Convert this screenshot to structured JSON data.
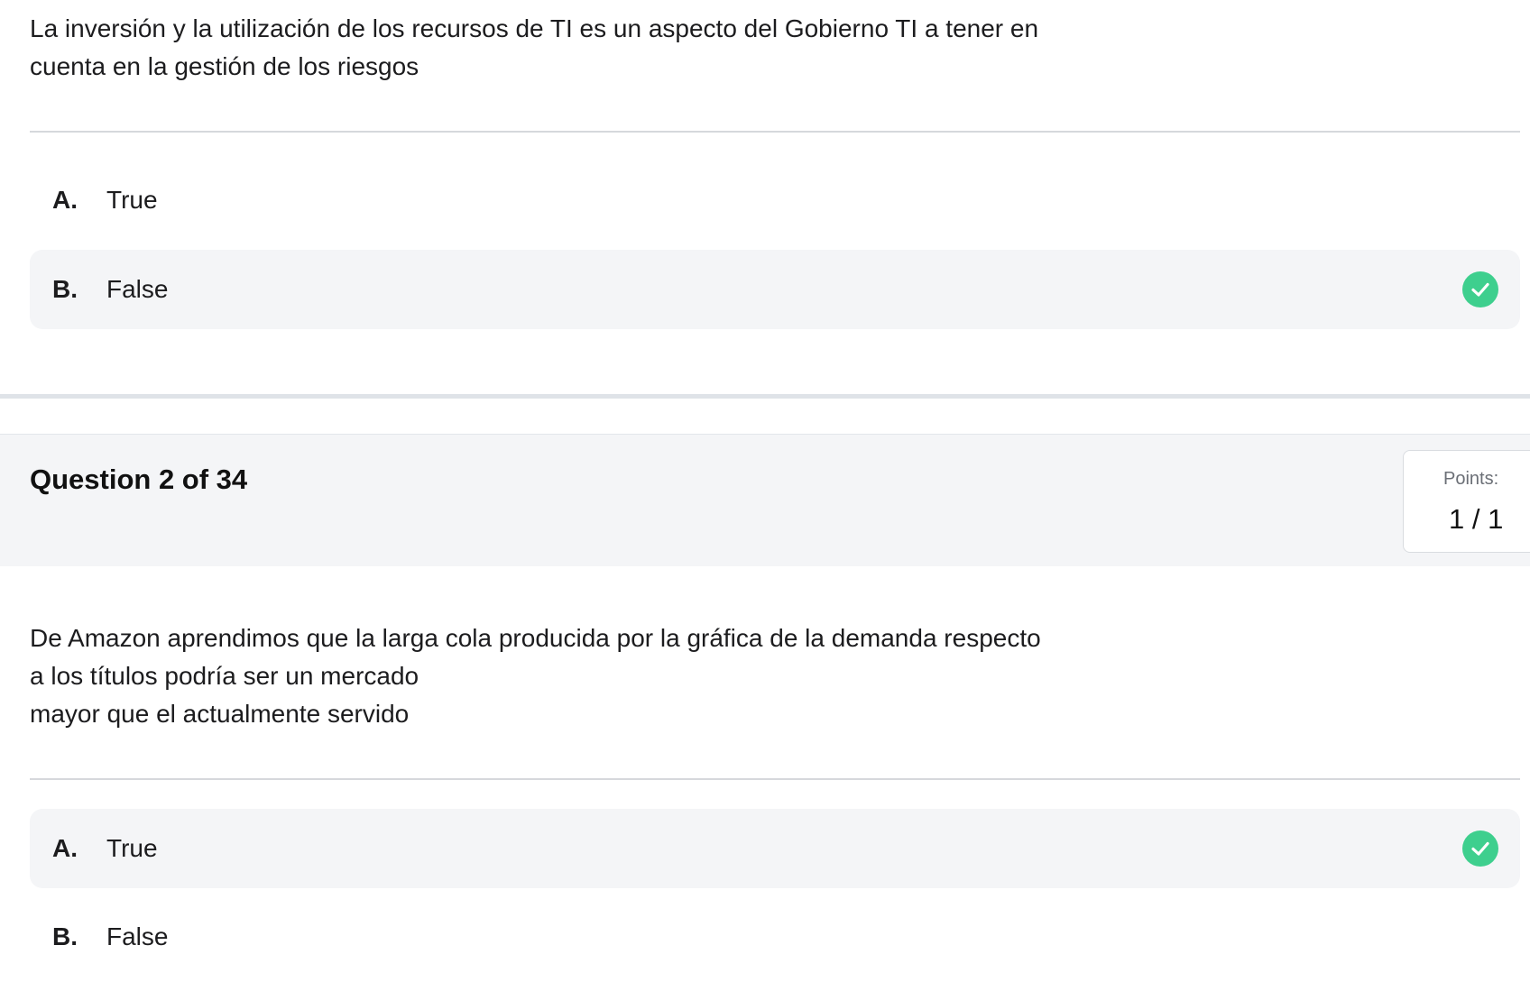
{
  "question1": {
    "text_lines": [
      "La inversión y la utilización de los recursos de TI es un aspecto del Gobierno TI a tener en",
      "cuenta en la gestión de los riesgos"
    ],
    "options": [
      {
        "letter": "A.",
        "label": "True",
        "selected": false,
        "correct": false
      },
      {
        "letter": "B.",
        "label": "False",
        "selected": true,
        "correct": true
      }
    ]
  },
  "question2": {
    "title": "Question 2 of 34",
    "points_label": "Points:",
    "points_value": "1 / 1",
    "text_lines": [
      "De Amazon aprendimos que la larga cola producida por la gráfica de la demanda respecto",
      "a los títulos podría ser un mercado",
      "mayor que el actualmente servido"
    ],
    "options": [
      {
        "letter": "A.",
        "label": "True",
        "selected": true,
        "correct": true
      },
      {
        "letter": "B.",
        "label": "False",
        "selected": false,
        "correct": false
      }
    ]
  },
  "colors": {
    "correct_check": "#3ecf8e",
    "selected_bg": "#f4f5f7",
    "divider": "#d6d8dc"
  }
}
